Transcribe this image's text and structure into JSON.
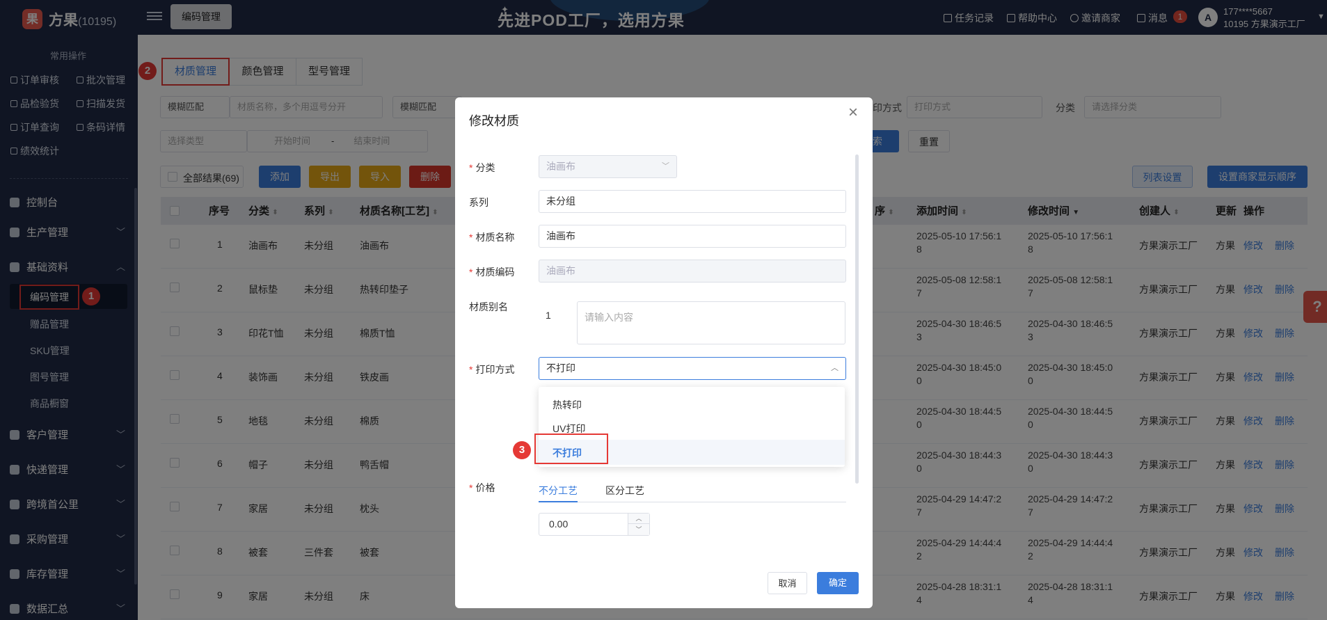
{
  "header": {
    "logo_glyph": "果",
    "brand": "方果",
    "brand_id": "(10195)",
    "active_tab": "编码管理",
    "slogan": "先进POD工厂，选用方果",
    "links": [
      "任务记录",
      "帮助中心",
      "邀请商家",
      "消息"
    ],
    "message_count": "1",
    "user_phone": "177****5667",
    "user_name": "10195 方果演示工厂"
  },
  "sidebar": {
    "common_title": "常用操作",
    "quick_actions": [
      "订单审核",
      "批次管理",
      "品检验货",
      "扫描发货",
      "订单查询",
      "条码详情",
      "绩效统计"
    ],
    "nav": [
      "控制台",
      "生产管理",
      "基础资料",
      "客户管理",
      "快递管理",
      "跨境首公里",
      "采购管理",
      "库存管理",
      "数据汇总"
    ],
    "sub_items": [
      "编码管理",
      "赠品管理",
      "SKU管理",
      "图号管理",
      "商品橱窗"
    ]
  },
  "page": {
    "tabs": [
      "材质管理",
      "颜色管理",
      "型号管理"
    ],
    "filters": {
      "match1": "模糊匹配",
      "name_placeholder": "材质名称，多个用逗号分开",
      "match2": "模糊匹配",
      "print_label": "印方式",
      "print_placeholder": "打印方式",
      "category_label": "分类",
      "category_placeholder": "请选择分类",
      "type_placeholder": "选择类型",
      "start_placeholder": "开始时间",
      "date_sep": "-",
      "end_placeholder": "结束时间",
      "search_fragment": "索",
      "reset": "重置"
    },
    "toolbar": {
      "select_all": "全部结果(69)",
      "add": "添加",
      "export": "导出",
      "import": "导入",
      "delete": "删除",
      "list_settings": "列表设置",
      "order_settings": "设置商家显示顺序"
    },
    "columns": [
      "序号",
      "分类",
      "系列",
      "材质名称[工艺]",
      "序",
      "添加时间",
      "修改时间",
      "创建人",
      "更新",
      "操作"
    ],
    "row_actions": [
      "修改",
      "删除"
    ],
    "rows": [
      {
        "no": "1",
        "category": "油画布",
        "series": "未分组",
        "name": "油画布",
        "added_1": "2025-05-10 17:56:1",
        "added_2": "8",
        "modified_1": "2025-05-10 17:56:1",
        "modified_2": "8",
        "creator": "方果演示工厂",
        "updater": "方果"
      },
      {
        "no": "2",
        "category": "鼠标垫",
        "series": "未分组",
        "name": "热转印垫子",
        "added_1": "2025-05-08 12:58:1",
        "added_2": "7",
        "modified_1": "2025-05-08 12:58:1",
        "modified_2": "7",
        "creator": "方果演示工厂",
        "updater": "方果"
      },
      {
        "no": "3",
        "category": "印花T恤",
        "series": "未分组",
        "name": "棉质T恤",
        "added_1": "2025-04-30 18:46:5",
        "added_2": "3",
        "modified_1": "2025-04-30 18:46:5",
        "modified_2": "3",
        "creator": "方果演示工厂",
        "updater": "方果"
      },
      {
        "no": "4",
        "category": "装饰画",
        "series": "未分组",
        "name": "铁皮画",
        "added_1": "2025-04-30 18:45:0",
        "added_2": "0",
        "modified_1": "2025-04-30 18:45:0",
        "modified_2": "0",
        "creator": "方果演示工厂",
        "updater": "方果"
      },
      {
        "no": "5",
        "category": "地毯",
        "series": "未分组",
        "name": "棉质",
        "added_1": "2025-04-30 18:44:5",
        "added_2": "0",
        "modified_1": "2025-04-30 18:44:5",
        "modified_2": "0",
        "creator": "方果演示工厂",
        "updater": "方果"
      },
      {
        "no": "6",
        "category": "帽子",
        "series": "未分组",
        "name": "鸭舌帽",
        "added_1": "2025-04-30 18:44:3",
        "added_2": "0",
        "modified_1": "2025-04-30 18:44:3",
        "modified_2": "0",
        "creator": "方果演示工厂",
        "updater": "方果"
      },
      {
        "no": "7",
        "category": "家居",
        "series": "未分组",
        "name": "枕头",
        "added_1": "2025-04-29 14:47:2",
        "added_2": "7",
        "modified_1": "2025-04-29 14:47:2",
        "modified_2": "7",
        "creator": "方果演示工厂",
        "updater": "方果"
      },
      {
        "no": "8",
        "category": "被套",
        "series": "三件套",
        "name": "被套",
        "added_1": "2025-04-29 14:44:4",
        "added_2": "2",
        "modified_1": "2025-04-29 14:44:4",
        "modified_2": "2",
        "creator": "方果演示工厂",
        "updater": "方果"
      },
      {
        "no": "9",
        "category": "家居",
        "series": "未分组",
        "name": "床",
        "added_1": "2025-04-28 18:31:1",
        "added_2": "4",
        "modified_1": "2025-04-28 18:31:1",
        "modified_2": "4",
        "creator": "方果演示工厂",
        "updater": "方果"
      }
    ]
  },
  "dialog": {
    "title": "修改材质",
    "fields": {
      "category_label": "分类",
      "category_value": "油画布",
      "series_label": "系列",
      "series_value": "未分组",
      "name_label": "材质名称",
      "name_value": "油画布",
      "code_label": "材质编码",
      "code_value": "油画布",
      "alias_label": "材质别名",
      "alias_index": "1",
      "alias_placeholder": "请输入内容",
      "print_label": "打印方式",
      "print_value": "不打印",
      "price_label": "价格",
      "price_tab_1": "不分工艺",
      "price_tab_2": "区分工艺",
      "price_value": "0.00"
    },
    "dropdown_options": [
      "热转印",
      "UV打印",
      "不打印"
    ],
    "selected_option": "不打印",
    "cancel": "取消",
    "confirm": "确定"
  },
  "annotations": [
    "1",
    "2",
    "3"
  ],
  "help_glyph": "?",
  "colors": {
    "sidebar": "#202b46",
    "primary": "#3b7ddd",
    "warning": "#e6a817",
    "danger": "#d9362b",
    "marker": "#e53935"
  }
}
